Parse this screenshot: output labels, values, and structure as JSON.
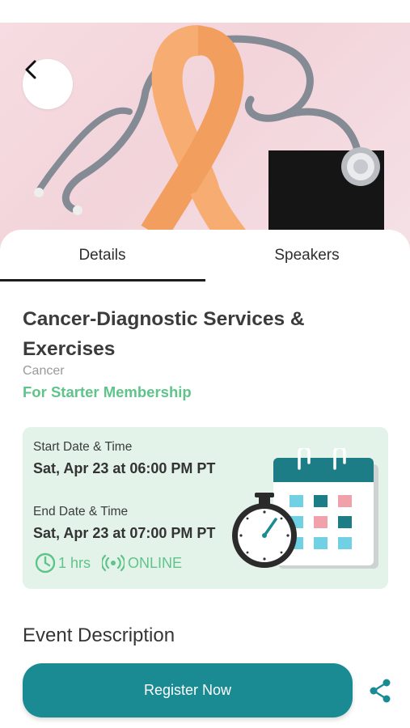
{
  "hero": {
    "image": "awareness-ribbon-stethoscope-photo"
  },
  "nav": {
    "back_icon": "chevron-left-icon"
  },
  "tabs": [
    {
      "label": "Details",
      "active": true
    },
    {
      "label": "Speakers",
      "active": false
    }
  ],
  "event": {
    "title": "Cancer-Diagnostic Services & Exercises",
    "category": "Cancer",
    "membership": "For Starter Membership",
    "start_label": "Start Date & Time",
    "start_value": "Sat, Apr 23 at 06:00 PM PT",
    "end_label": "End Date & Time",
    "end_value": "Sat, Apr 23 at 07:00 PM PT",
    "duration": "1 hrs",
    "mode": "ONLINE",
    "description_title": "Event Description"
  },
  "actions": {
    "register_label": "Register Now",
    "share_icon": "share-icon"
  },
  "colors": {
    "accent": "#1a8a93",
    "green": "#5fc48a",
    "card_bg": "#e3f3e9"
  }
}
